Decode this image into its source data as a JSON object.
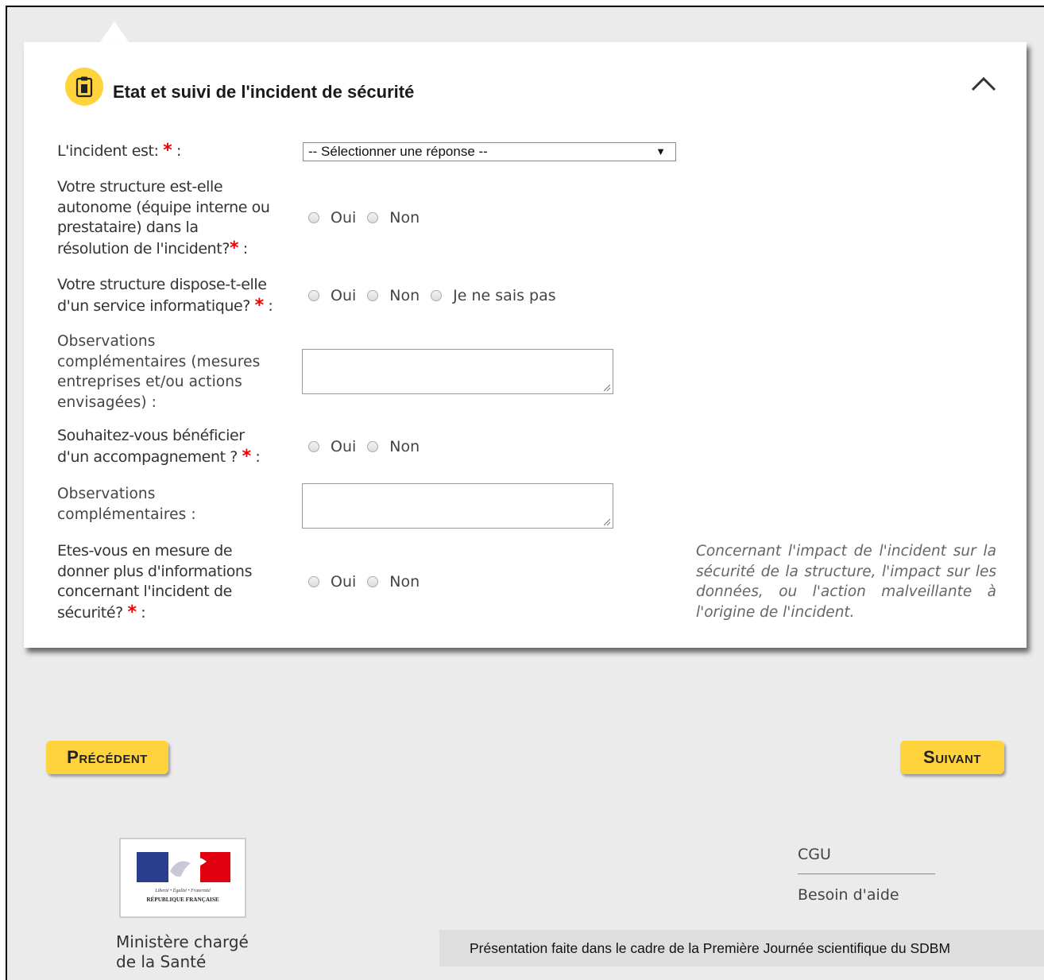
{
  "section": {
    "title": "Etat et suivi de l'incident de sécurité",
    "icon": "clipboard-icon",
    "accent_color": "#ffd33b"
  },
  "form": {
    "q1": {
      "label": "L'incident est:",
      "suffix": ":",
      "select_value": "-- Sélectionner une réponse --"
    },
    "q2": {
      "label_lines": [
        "Votre structure est-elle",
        "autonome (équipe interne ou",
        "prestataire) dans la",
        "résolution de l'incident?"
      ],
      "suffix": ":",
      "options": [
        "Oui",
        "Non"
      ]
    },
    "q3": {
      "label_lines": [
        "Votre structure dispose-t-elle",
        "d'un service informatique?"
      ],
      "suffix": ":",
      "options": [
        "Oui",
        "Non",
        "Je ne sais pas"
      ]
    },
    "q4": {
      "label_lines": [
        "Observations",
        "complémentaires (mesures",
        "entreprises et/ou actions",
        "envisagées) :"
      ]
    },
    "q5": {
      "label_lines": [
        "Souhaitez-vous bénéficier",
        "d'un accompagnement ?"
      ],
      "suffix": ":",
      "options": [
        "Oui",
        "Non"
      ]
    },
    "q6": {
      "label_lines": [
        "Observations",
        "complémentaires :"
      ]
    },
    "q7": {
      "label_lines": [
        "Etes-vous en mesure de",
        "donner plus d'informations",
        "concernant l'incident de",
        "sécurité?"
      ],
      "suffix": ":",
      "options": [
        "Oui",
        "Non"
      ]
    },
    "required_mark": "*",
    "hint": "Concernant l'impact de l'incident sur la sécurité de la structure, l'impact sur les données, ou l'action malveillante à l'origine de l'incident."
  },
  "nav": {
    "prev_label": "Précédent",
    "next_label": "Suivant"
  },
  "footer": {
    "ministry_lines": [
      "Ministère chargé",
      "de la Santé"
    ],
    "logo_motto": "Liberté • Égalité • Fraternité",
    "logo_name": "RÉPUBLIQUE FRANÇAISE",
    "links": [
      "CGU",
      "Besoin d'aide"
    ],
    "caption": "Présentation faite dans le cadre de la Première Journée scientifique du SDBM"
  }
}
